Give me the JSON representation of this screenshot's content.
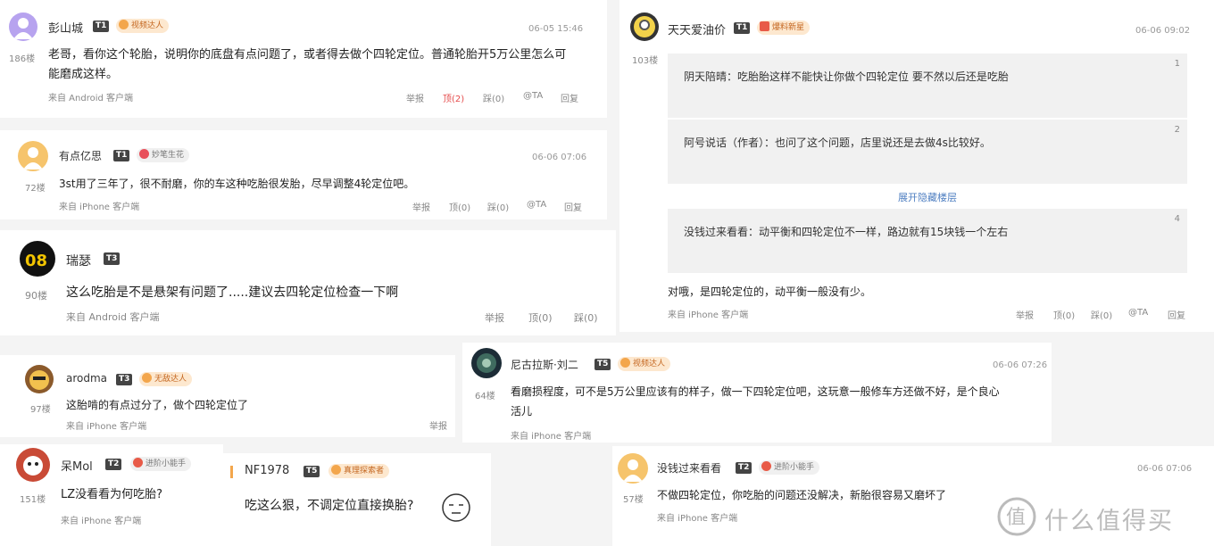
{
  "colors": {
    "link": "#4f7fc1",
    "liked": "#e54b4b",
    "badge_bg": "#fde8cf",
    "badge_text": "#c4661f"
  },
  "c1": {
    "user": "彭山城",
    "level": "T1",
    "badge": "视频达人",
    "time": "06-05 15:46",
    "floor": "186楼",
    "text1": "老哥，看你这个轮胎，说明你的底盘有点问题了，或者得去做个四轮定位。普通轮胎开5万公里怎么可",
    "text2": "能磨成这样。",
    "src": "来自 Android 客户端",
    "actions": [
      "举报",
      "顶(2)",
      "踩(0)",
      "@TA",
      "回复"
    ]
  },
  "c2": {
    "user": "有点亿思",
    "level": "T1",
    "badge": "妙笔生花",
    "time": "06-06 07:06",
    "floor": "72楼",
    "text": "3st用了三年了，很不耐磨，你的车这种吃胎很发胎，尽早调整4轮定位吧。",
    "src": "来自 iPhone 客户端",
    "actions": [
      "举报",
      "顶(0)",
      "踩(0)",
      "@TA",
      "回复"
    ]
  },
  "c3": {
    "user": "瑞瑟",
    "level": "T3",
    "floor": "90楼",
    "text": "这么吃胎是不是悬架有问题了.....建议去四轮定位检查一下啊",
    "src": "来自 Android 客户端",
    "actions": [
      "举报",
      "顶(0)",
      "踩(0)"
    ]
  },
  "c4": {
    "user": "arodma",
    "level": "T3",
    "badge": "无敌达人",
    "floor": "97楼",
    "text": "这胎啃的有点过分了，做个四轮定位了",
    "src": "来自 iPhone 客户端",
    "actions": [
      "举报"
    ]
  },
  "c5": {
    "user": "呆Mol",
    "level": "T2",
    "badge": "进阶小能手",
    "floor": "151楼",
    "text": "LZ没看看为何吃胎?",
    "src": "来自 iPhone 客户端"
  },
  "c6": {
    "user": "NF1978",
    "level": "T5",
    "badge": "真理探索者",
    "text": "吃这么狠，不调定位直接换胎?"
  },
  "c7": {
    "user": "天天爱油价",
    "level": "T1",
    "badge": "爆料新星",
    "time": "06-06 09:02",
    "floor": "103楼",
    "replies": [
      {
        "text": "阴天陪晴：吃胎胎这样不能快让你做个四轮定位 要不然以后还是吃胎",
        "num": "1"
      },
      {
        "text": "阿号说话（作者）：也问了这个问题，店里说还是去做4s比较好。",
        "num": "2"
      },
      {
        "text": "没钱过来看看：动平衡和四轮定位不一样，路边就有15块钱一个左右",
        "num": "4"
      }
    ],
    "expand": "展开隐藏楼层",
    "text": "对哦，是四轮定位的，动平衡一般没有少。",
    "src": "来自 iPhone 客户端",
    "actions": [
      "举报",
      "顶(0)",
      "踩(0)",
      "@TA",
      "回复"
    ]
  },
  "c8": {
    "user": "尼古拉斯·刘二",
    "level": "T5",
    "badge": "视频达人",
    "time": "06-06 07:26",
    "floor": "64楼",
    "text1": "看磨损程度，可不是5万公里应该有的样子，做一下四轮定位吧，这玩意一般修车方还做不好，是个良心",
    "text2": "活儿",
    "src": "来自 iPhone 客户端"
  },
  "c9": {
    "user": "没钱过来看看",
    "level": "T2",
    "badge": "进阶小能手",
    "time": "06-06 07:06",
    "floor": "57楼",
    "text": "不做四轮定位，你吃胎的问题还没解决，新胎很容易又磨坏了",
    "src": "来自 iPhone 客户端"
  },
  "watermark": "什么值得买",
  "watermark_icon": "zhi-logo-icon"
}
